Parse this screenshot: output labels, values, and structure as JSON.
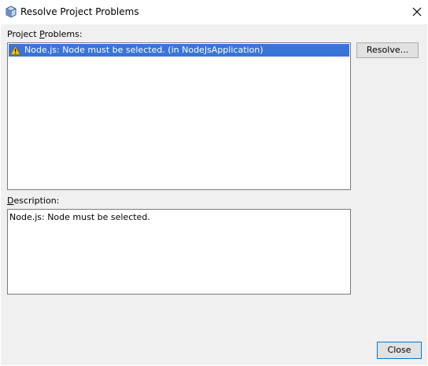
{
  "window": {
    "title": "Resolve Project Problems",
    "icon": "netbeans-cube-icon"
  },
  "problems": {
    "label_prefix": "Project ",
    "label_mnemonic": "P",
    "label_suffix": "roblems:",
    "items": [
      {
        "text": "Node.js: Node must be selected. (in NodeJsApplication)",
        "icon": "warning-icon",
        "selected": true
      }
    ]
  },
  "resolve_button": {
    "label": "Resolve..."
  },
  "description": {
    "label_mnemonic": "D",
    "label_suffix": "escription:",
    "text": "Node.js: Node must be selected."
  },
  "close_button": {
    "label": "Close"
  },
  "colors": {
    "selection": "#3875d7",
    "dialog_bg": "#f0f0f0",
    "button_bg": "#e1e1e1",
    "focus_border": "#0078d7",
    "warning": "#f5c211"
  }
}
